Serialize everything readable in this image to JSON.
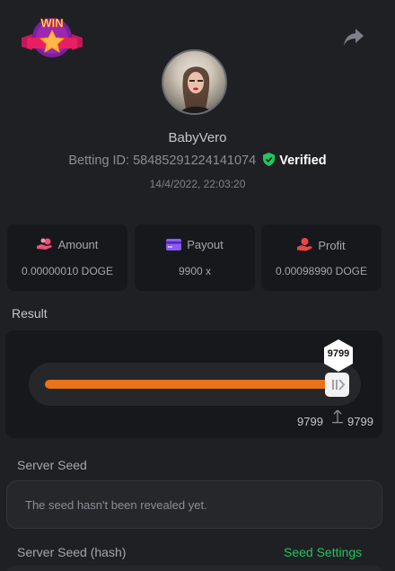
{
  "header": {
    "logo_text": "WIN",
    "logo_icon": "win-badge-logo",
    "share_icon": "share-arrow-icon"
  },
  "profile": {
    "username": "BabyVero",
    "betting_id_label": "Betting ID:",
    "betting_id": "58485291224141074",
    "verified_label": "Verified",
    "datetime": "14/4/2022, 22:03:20"
  },
  "cards": [
    {
      "label": "Amount",
      "value": "0.00000010 DOGE",
      "icon": "coins-hand-icon"
    },
    {
      "label": "Payout",
      "value": "9900 x",
      "icon": "wallet-card-icon"
    },
    {
      "label": "Profit",
      "value": "0.00098990 DOGE",
      "icon": "money-hand-icon"
    }
  ],
  "result": {
    "title": "Result",
    "roll_value": "9799",
    "target_left": "9799",
    "target_right": "9799",
    "fill_fraction": 0.98
  },
  "seeds": {
    "server_seed_label": "Server Seed",
    "server_seed_placeholder": "The seed hasn't been revealed yet.",
    "server_seed_hash_label": "Server Seed (hash)",
    "seed_settings_link": "Seed Settings"
  },
  "colors": {
    "background": "#1f2023",
    "accent_orange": "#e8731a",
    "verified_green": "#22c55e",
    "link_green": "#22c55e",
    "payout_purple": "#8b5cf6",
    "amount_pink": "#ef4f7a",
    "profit_red": "#ef4444"
  }
}
